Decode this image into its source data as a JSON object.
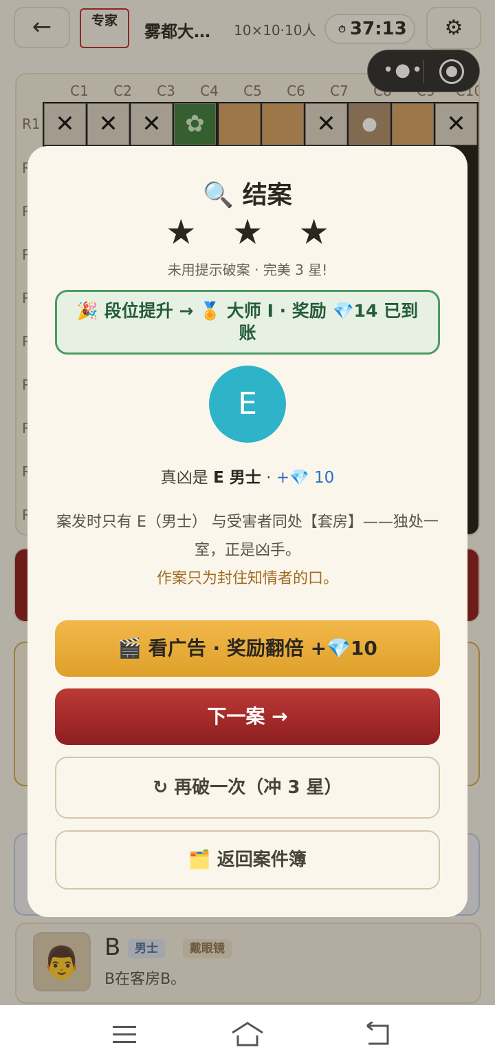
{
  "header": {
    "back_icon": "arrow-left-icon",
    "difficulty": "专家",
    "case_title": "雾都大…",
    "grid_meta": "10×10·10人",
    "timer": "37:13",
    "settings_icon": "gear-icon"
  },
  "mini_capsule": {
    "more_icon": "more-dots-icon",
    "close_icon": "target-close-icon"
  },
  "board": {
    "columns": [
      "C1",
      "C2",
      "C3",
      "C4",
      "C5",
      "C6",
      "C7",
      "C8",
      "C9",
      "C10"
    ],
    "rows": [
      "R1",
      "R",
      "R",
      "R",
      "R",
      "R",
      "R",
      "R",
      "R",
      "R"
    ]
  },
  "suspect": {
    "name": "B",
    "tags": [
      "男士",
      "戴眼镜"
    ],
    "description": "B在客房B。"
  },
  "modal": {
    "title": "🔍 结案",
    "stars": "★ ★ ★",
    "star_count": 3,
    "perfect_note": "未用提示破案 · 完美 3 星!",
    "rank_text": "🎉 段位提升 → 🏅 大师 I · 奖励 💎14 已到账",
    "culprit_letter": "E",
    "culprit_prefix": "真凶是 ",
    "culprit_name": "E 男士",
    "culprit_sep": " · ",
    "culprit_reward": "+💎 10",
    "explain_1": "案发时只有 E（男士） 与受害者同处【套房】——独处一室，正是凶手。",
    "explain_2": "作案只为封住知情者的口。",
    "btn_ad": "🎬 看广告 · 奖励翻倍 +💎10",
    "btn_next": "下一案 →",
    "btn_retry": "↻ 再破一次（冲 3 星）",
    "btn_back": "🗂️ 返回案件簿"
  },
  "colors": {
    "accent_red": "#9b2525",
    "accent_gold": "#e6a935",
    "rank_green": "#4c9a63",
    "culprit_teal": "#2fb3c8"
  }
}
